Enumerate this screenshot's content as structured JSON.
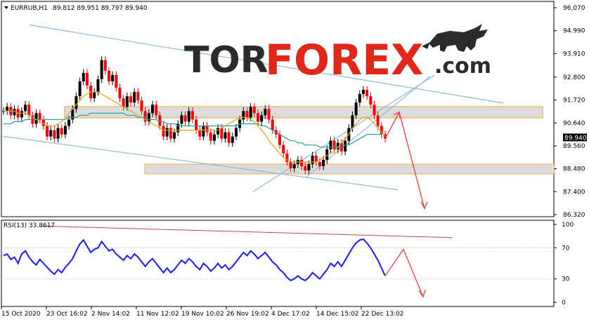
{
  "header": {
    "symbol_label": "EURRUB,H1",
    "ohlc_values": "89.812 89.951 89.797 89.940"
  },
  "logo": {
    "part1": "TOR",
    "part2": "FOREX",
    "part3": ".com"
  },
  "colors": {
    "bull": "#000000",
    "bear": "#ff0000",
    "ma_fast": "#e8a317",
    "ma_slow": "#2aa198",
    "channel": "#8fb8d8",
    "zone_fill": "#dcdcdc",
    "zone_border": "#f0a64a",
    "rsi_line": "#1a1aff",
    "forecast_arrow": "#f04040",
    "logo_dark": "#2b2b2b",
    "logo_red": "#e0271a"
  },
  "chart_data": [
    {
      "type": "candlestick",
      "symbol": "EURRUB",
      "timeframe": "H1",
      "current_price": "89.940",
      "ylim": [
        86.32,
        96.07
      ],
      "yticks": [
        "96.070",
        "94.990",
        "93.910",
        "92.800",
        "91.720",
        "90.640",
        "89.560",
        "88.480",
        "87.400",
        "86.320"
      ],
      "xticks": [
        "15 Oct 2020",
        "23 Oct 16:02",
        "2 Nov 14:02",
        "11 Nov 12:02",
        "19 Nov 10:02",
        "26 Nov 19:02",
        "4 Dec 17:02",
        "14 Dec 15:02",
        "22 Dec 13:02"
      ],
      "close_series": [
        91.2,
        91.4,
        91.0,
        91.3,
        90.9,
        91.2,
        91.5,
        91.0,
        90.6,
        91.1,
        90.8,
        90.5,
        90.0,
        90.3,
        89.9,
        90.4,
        90.1,
        90.5,
        90.8,
        91.3,
        91.9,
        92.6,
        93.0,
        92.4,
        91.8,
        92.1,
        92.7,
        93.6,
        93.1,
        92.6,
        92.9,
        92.3,
        91.8,
        91.4,
        91.9,
        91.6,
        92.1,
        91.7,
        91.2,
        90.7,
        91.1,
        91.5,
        91.0,
        90.5,
        90.0,
        90.4,
        89.9,
        90.2,
        90.6,
        91.0,
        90.7,
        91.2,
        90.8,
        90.3,
        90.0,
        90.5,
        90.2,
        89.8,
        90.1,
        90.4,
        89.9,
        90.2,
        89.7,
        90.0,
        90.4,
        90.8,
        91.2,
        90.9,
        91.4,
        91.1,
        90.7,
        91.0,
        91.3,
        90.8,
        90.3,
        90.1,
        89.6,
        89.2,
        88.8,
        88.5,
        88.7,
        88.9,
        88.6,
        88.4,
        88.7,
        89.1,
        88.8,
        88.6,
        88.9,
        89.4,
        89.8,
        89.4,
        89.7,
        89.3,
        89.8,
        90.4,
        91.0,
        91.6,
        92.0,
        92.2,
        91.9,
        91.5,
        91.0,
        90.5,
        90.1,
        89.9
      ],
      "ma_fast": [
        91.2,
        91.2,
        91.2,
        91.2,
        91.1,
        91.1,
        91.1,
        91.0,
        90.9,
        90.8,
        90.7,
        90.6,
        90.5,
        90.5,
        90.5,
        90.6,
        90.7,
        90.9,
        91.1,
        91.3,
        91.5,
        91.7,
        91.9,
        92.0,
        92.1,
        92.1,
        92.1,
        92.0,
        91.9,
        91.8,
        91.7,
        91.6,
        91.5,
        91.4,
        91.3,
        91.2,
        91.1,
        91.0,
        90.9,
        90.8,
        90.7,
        90.6,
        90.5,
        90.4,
        90.3,
        90.3,
        90.3,
        90.3,
        90.3,
        90.3,
        90.3,
        90.3,
        90.3,
        90.3,
        90.3,
        90.3,
        90.3,
        90.3,
        90.3,
        90.3,
        90.4,
        90.5,
        90.6,
        90.7,
        90.8,
        90.9,
        90.9,
        90.9,
        90.8,
        90.7,
        90.5,
        90.3,
        90.1,
        89.8,
        89.6,
        89.4,
        89.2,
        89.0,
        88.9,
        88.8,
        88.8,
        88.8,
        88.8,
        88.8,
        88.8,
        88.8,
        88.8,
        88.9,
        89.0,
        89.1,
        89.2,
        89.3,
        89.5,
        89.7,
        89.9,
        90.1,
        90.4,
        90.6,
        90.8,
        90.9,
        90.9,
        90.8,
        90.6,
        90.4,
        90.2,
        90.0
      ],
      "ma_slow": [
        90.6,
        90.6,
        90.6,
        90.7,
        90.7,
        90.7,
        90.8,
        90.8,
        90.8,
        90.8,
        90.8,
        90.8,
        90.8,
        90.8,
        90.8,
        90.8,
        90.8,
        90.8,
        90.9,
        90.9,
        90.9,
        91.0,
        91.0,
        91.0,
        91.1,
        91.1,
        91.1,
        91.1,
        91.1,
        91.1,
        91.1,
        91.1,
        91.1,
        91.1,
        91.0,
        91.0,
        91.0,
        90.9,
        90.9,
        90.9,
        90.8,
        90.8,
        90.8,
        90.7,
        90.7,
        90.6,
        90.6,
        90.6,
        90.5,
        90.5,
        90.5,
        90.5,
        90.5,
        90.5,
        90.5,
        90.5,
        90.5,
        90.5,
        90.5,
        90.5,
        90.5,
        90.5,
        90.5,
        90.5,
        90.5,
        90.6,
        90.6,
        90.6,
        90.6,
        90.6,
        90.6,
        90.5,
        90.5,
        90.4,
        90.3,
        90.2,
        90.1,
        90.0,
        89.9,
        89.8,
        89.8,
        89.7,
        89.7,
        89.6,
        89.6,
        89.6,
        89.6,
        89.5,
        89.5,
        89.5,
        89.5,
        89.5,
        89.5,
        89.5,
        89.6,
        89.6,
        89.7,
        89.8,
        89.9,
        90.0,
        90.1,
        90.1,
        90.1,
        90.1,
        90.1,
        90.1
      ],
      "resistance_zone": [
        90.88,
        91.41
      ],
      "support_zone": [
        88.24,
        88.7
      ],
      "downtrend_channel": [
        {
          "from": [
            "15 Oct 2020",
            95.26
          ],
          "to": [
            "22 Dec 13:02",
            91.58
          ]
        },
        {
          "from": [
            "15 Oct 2020",
            90.01
          ],
          "to": [
            "22 Dec 13:02",
            87.49
          ]
        }
      ],
      "uptrend_channel": [
        {
          "from": [
            "4 Dec 17:02",
            87.4
          ],
          "to": [
            "22 Dec 13:02",
            92.89
          ]
        },
        {
          "from": [
            "4 Dec 17:02",
            88.1
          ],
          "to": [
            "22 Dec 13:02",
            92.84
          ]
        }
      ],
      "forecast_path": [
        89.9,
        91.15,
        86.6
      ]
    },
    {
      "type": "line",
      "indicator_label": "RSI(13) 33.8617",
      "ylim": [
        0,
        100
      ],
      "yticks": [
        "100",
        "70",
        "30",
        "0"
      ],
      "values": [
        60,
        62,
        55,
        58,
        50,
        62,
        66,
        58,
        52,
        48,
        55,
        50,
        45,
        40,
        36,
        42,
        38,
        45,
        50,
        56,
        66,
        75,
        80,
        72,
        64,
        68,
        70,
        78,
        72,
        66,
        68,
        62,
        58,
        54,
        60,
        56,
        62,
        58,
        52,
        46,
        52,
        56,
        50,
        44,
        38,
        44,
        38,
        42,
        48,
        54,
        50,
        56,
        52,
        46,
        42,
        50,
        46,
        40,
        44,
        50,
        44,
        48,
        42,
        46,
        52,
        58,
        64,
        60,
        66,
        62,
        56,
        60,
        64,
        58,
        52,
        48,
        42,
        38,
        32,
        28,
        30,
        34,
        30,
        28,
        32,
        38,
        34,
        30,
        36,
        42,
        50,
        46,
        52,
        46,
        54,
        62,
        70,
        76,
        80,
        81,
        76,
        70,
        62,
        54,
        44,
        34
      ],
      "trendline": {
        "from": [
          "23 Oct 16:02",
          98
        ],
        "to": [
          "22 Dec 13:02",
          83
        ]
      },
      "forecast_path": [
        34,
        68,
        7
      ]
    }
  ]
}
